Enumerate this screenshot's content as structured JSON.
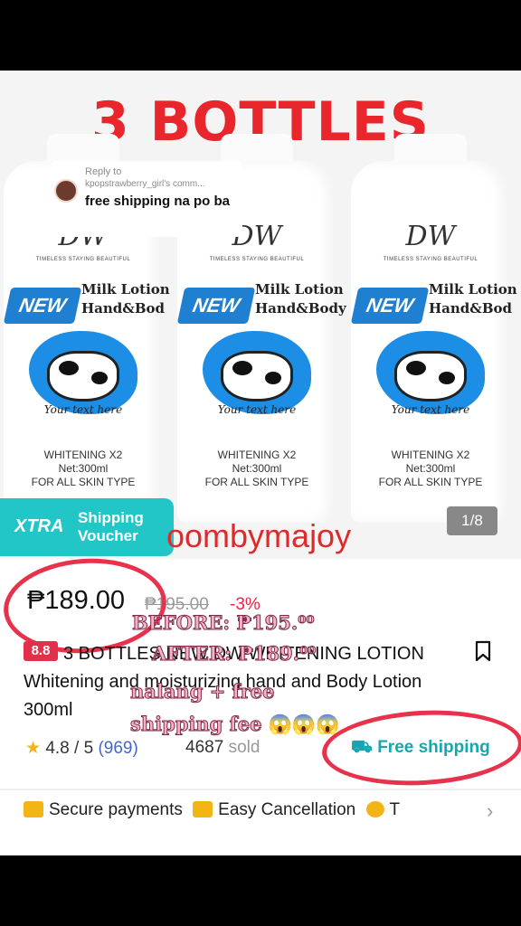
{
  "hero": {
    "title": "3 BOTTLES",
    "bottles": [
      {
        "brand": "DW",
        "brand_sub": "TIMELESS STAYING BEAUTIFUL",
        "badge": "NEW",
        "name_line1": "Milk Lotion",
        "name_line2": "Hand&Bod",
        "your_text": "Your text here",
        "line1": "WHITENING X2",
        "line2": "Net:300ml",
        "line3": "FOR ALL SKIN TYPE"
      },
      {
        "brand": "DW",
        "brand_sub": "TIMELESS STAYING BEAUTIFUL",
        "badge": "NEW",
        "name_line1": "Milk Lotion",
        "name_line2": "Hand&Body",
        "your_text": "Your text here",
        "line1": "WHITENING X2",
        "line2": "Net:300ml",
        "line3": "FOR ALL SKIN TYPE"
      },
      {
        "brand": "DW",
        "brand_sub": "TIMELESS STAYING BEAUTIFUL",
        "badge": "NEW",
        "name_line1": "Milk Lotion",
        "name_line2": "Hand&Bod",
        "your_text": "Your text here",
        "line1": "WHITENING X2",
        "line2": "Net:300ml",
        "line3": "FOR ALL SKIN TYPE"
      }
    ],
    "reply": {
      "label": "Reply to",
      "user": "kpopstrawberry_girl's comm...",
      "text": "free shipping na po ba"
    },
    "voucher": {
      "brand": "XTRA",
      "line1": "Shipping",
      "line2": "Voucher"
    },
    "shop_name": "oombymajoy",
    "pager": "1/8"
  },
  "product": {
    "price": "₱189.00",
    "old_price": "₱195.00",
    "discount": "-3%",
    "badge": "8.8",
    "title": "3 BOTTLES NEW DW WHITENING LOTION Whitening and moisturizing hand and Body Lotion 300ml",
    "rating": "4.8 / 5",
    "rating_count": "(969)",
    "sold_count": "4687",
    "sold_label": "sold",
    "free_shipping": "Free shipping",
    "trust": [
      "Secure payments",
      "Easy Cancellation",
      "T"
    ]
  },
  "overlay": {
    "before": "BEFORE: ₱195.⁰⁰",
    "after": "AFTER:   ₱189.⁰⁰",
    "line3": "nalang + free",
    "line4": "shipping fee 😱😱😱"
  },
  "colors": {
    "accent_red": "#e8262c",
    "teal": "#23c6c6",
    "highlight_circle": "#e8324c"
  }
}
